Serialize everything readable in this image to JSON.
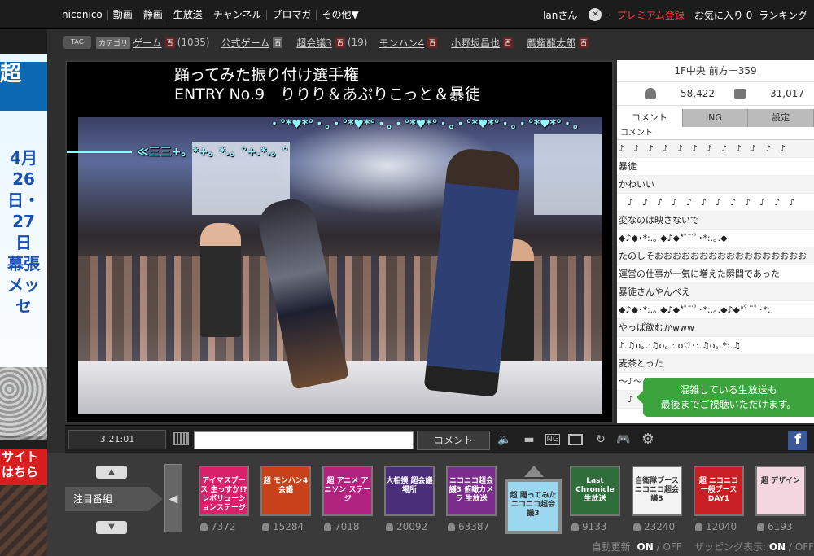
{
  "nav": {
    "brand": "niconico",
    "items": [
      "動画",
      "静画",
      "生放送",
      "チャンネル",
      "ブロマガ",
      "その他▼"
    ],
    "user": "lanさん",
    "dash": "-",
    "premium": "プレミアム登録",
    "favorites": "お気に入り 0",
    "ranking": "ランキング"
  },
  "left_banner": {
    "top_chars": "超",
    "dates": "4月26日・27日",
    "venue": "幕張メッセ",
    "red_text": "サイトはちら"
  },
  "tags": {
    "icon": "TAG",
    "category_badge": "カテゴリ",
    "items": [
      {
        "name": "ゲーム",
        "count": "(1035)"
      },
      {
        "name": "公式ゲーム",
        "count": ""
      },
      {
        "name": "超会議3",
        "count": "(19)"
      },
      {
        "name": "モンハン4",
        "count": ""
      },
      {
        "name": "小野坂昌也",
        "count": ""
      },
      {
        "name": "鷹觜龍太郎",
        "count": ""
      }
    ],
    "dic_label": "百"
  },
  "player": {
    "title_line1": "踊ってみた振り付け選手権",
    "title_line2": "ENTRY No.9　りりり＆あぷりこっと＆暴徒",
    "danmaku": [
      "・°*♥*°・。・°*♥*°・。・°*♥*°・。・°*♥*°・。・°*♥*°・。",
      "≪三三+。*+。*.。°+.*.。°"
    ]
  },
  "controls": {
    "time": "3:21:01",
    "comment_button": "コメント",
    "input_value": "",
    "icons": [
      "keyboard-icon",
      "speaker-icon",
      "comment-icon",
      "ng-icon",
      "screen-icon",
      "reload-icon",
      "app-icon",
      "gear-icon",
      "facebook-icon"
    ],
    "fb_glyph": "f"
  },
  "right_panel": {
    "seat": "1F中央 前方－359",
    "viewers": "58,422",
    "comments": "31,017",
    "tabs": [
      "コメント",
      "NG",
      "設定"
    ],
    "header": "コメント",
    "rows": [
      "♪　♪　♪　♪　♪　♪　♪　♪　♪　♪　♪　♪",
      "暴徒",
      "かわいい",
      "　♪　♪　♪　♪　♪　♪　♪　♪　♪　♪　♪　♪",
      "変なのは映さないで",
      "◆♪◆･*:.｡.◆♪◆*ﾟ¨ﾟ･*:.｡.◆",
      "たのしそおおおおおおおおおおおおおおおおお",
      "運営の仕事が一気に増えた瞬間であった",
      "暴徒さんやんべえ",
      "◆♪◆･*:.｡.◆♪◆*ﾟ¨ﾟ･*:.｡.◆♪◆*ﾟ¨ﾟ･*:.",
      "やっぱ飲むかwww",
      "♪.♫o｡.:♫o｡.:.o♡･:.♫o｡.*:.♫",
      "麦茶とった",
      "～♪～♪～♪～♪～♪～",
      "　♪"
    ],
    "toast_line1": "混雑している生放送も",
    "toast_line2": "最後までご視聴いただけます。"
  },
  "bottom": {
    "attention": "注目番組",
    "programs": [
      {
        "label": "アイマスブース 生っすか!? レボリューションステージ",
        "count": "7372",
        "color": "#d8206b"
      },
      {
        "label": "超 モンハン4 会議",
        "count": "15284",
        "color": "#c7411a"
      },
      {
        "label": "超 アニメ アニソン ステージ",
        "count": "7018",
        "color": "#b0237f"
      },
      {
        "label": "大相撲 超会議場所",
        "count": "20092",
        "color": "#4b2f7a"
      },
      {
        "label": "ニコニコ超会議3 俯瞰カメラ 生放送",
        "count": "63387",
        "color": "#7a2d8a"
      },
      {
        "label": "超 踊ってみた ニコニコ超会議3",
        "count": "",
        "color": "#9bd8f0"
      },
      {
        "label": "Last Chronicle 生放送",
        "count": "9133",
        "color": "#2f6e3a"
      },
      {
        "label": "自衛隊ブース ニコニコ超会議3",
        "count": "23240",
        "color": "#f3f3f3"
      },
      {
        "label": "超 ニコニコ 一般ブース DAY1",
        "count": "12040",
        "color": "#c71f24"
      },
      {
        "label": "超 デザイン",
        "count": "6193",
        "color": "#f4d6e0"
      }
    ],
    "auto_update": "自動更新:",
    "zapping": "ザッピング表示:",
    "on": "ON",
    "off": "OFF",
    "up_arrow": "▲",
    "down_arrow": "▼",
    "left_arrow": "◀"
  }
}
